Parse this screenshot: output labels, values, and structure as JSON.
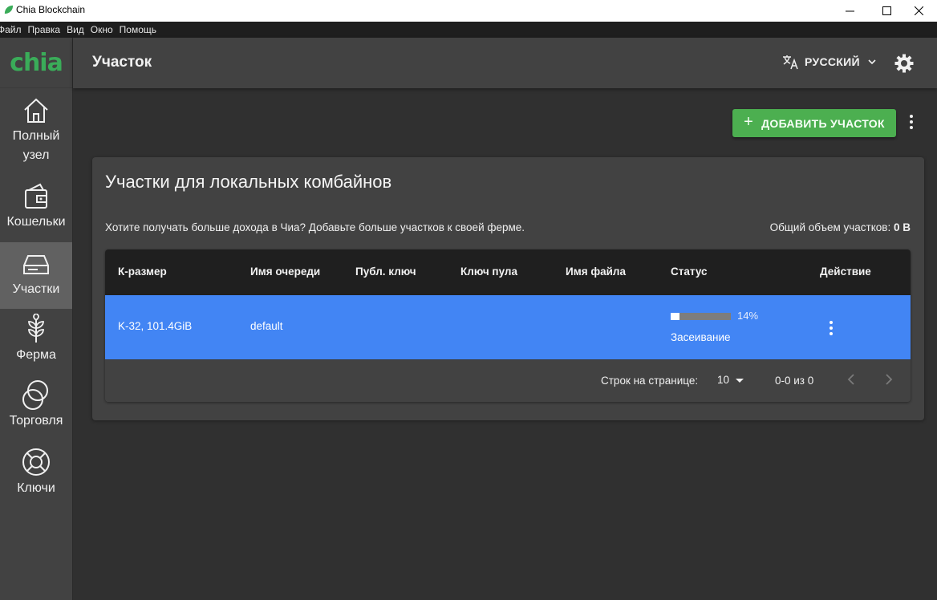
{
  "window": {
    "title": "Chia Blockchain",
    "minimize_glyph": "—",
    "maximize_glyph": "☐",
    "close_glyph": "✕"
  },
  "menu": [
    "Файл",
    "Правка",
    "Вид",
    "Окно",
    "Помощь"
  ],
  "sidebar": {
    "logo": "chia",
    "items": [
      {
        "label_line1": "Полный",
        "label_line2": "узел",
        "icon": "home-icon"
      },
      {
        "label_line1": "Кошельки",
        "icon": "wallet-icon"
      },
      {
        "label_line1": "Участки",
        "icon": "hard-drive-icon",
        "active": true
      },
      {
        "label_line1": "Ферма",
        "icon": "sprout-icon"
      },
      {
        "label_line1": "Торговля",
        "icon": "trade-circles-icon"
      },
      {
        "label_line1": "Ключи",
        "icon": "lifebuoy-icon"
      }
    ]
  },
  "header": {
    "title": "Участок",
    "language": "РУССКИЙ"
  },
  "toolbar": {
    "add_plot_label": "ДОБАВИТЬ УЧАСТОК"
  },
  "card": {
    "title": "Участки для локальных комбайнов",
    "subtitle": "Хотите получать больше дохода в Чиа? Добавьте больше участков к своей ферме.",
    "total_label": "Общий объем участков:",
    "total_value": "0 B"
  },
  "table": {
    "columns": [
      "К-размер",
      "Имя очереди",
      "Публ. ключ",
      "Ключ пула",
      "Имя файла",
      "Статус",
      "Действие"
    ],
    "rows": [
      {
        "k_size": "K-32, 101.4GiB",
        "queue": "default",
        "progress": 14,
        "progress_label": "14%",
        "status": "Засеивание"
      }
    ],
    "footer": {
      "rows_per_page_label": "Строк на странице:",
      "rows_per_page": "10",
      "range": "0-0 из 0"
    }
  },
  "colors": {
    "accent_green": "#4caf50",
    "row_selected": "#4285f4",
    "logo_green": "#3aac59"
  }
}
